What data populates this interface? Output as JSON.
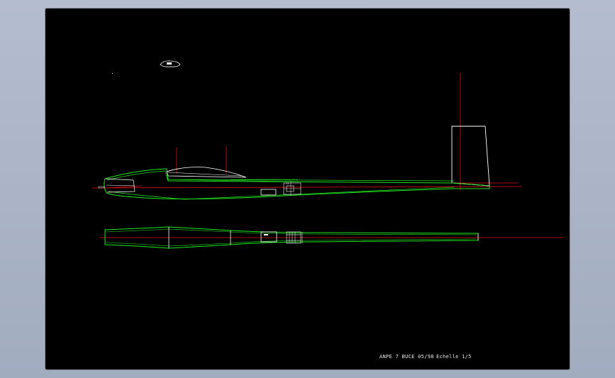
{
  "drawing": {
    "title_block": "ANPE 7 BUCE 05/98",
    "scale_label": "Echelle 1/5"
  },
  "colors": {
    "background": "#000000",
    "outline_green": "#1fe41f",
    "outline_white": "#ffffff",
    "axis_red": "#e01010",
    "frame": "#a9b3c6"
  }
}
